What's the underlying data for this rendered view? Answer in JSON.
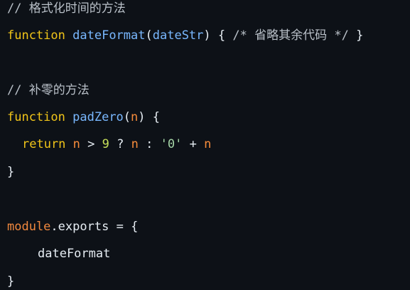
{
  "code": {
    "line1": {
      "comment": "// 格式化时间的方法"
    },
    "line2": {
      "keyword": "function",
      "fn_name": "dateFormat",
      "open_paren": "(",
      "param": "dateStr",
      "close_paren": ")",
      "brace_open": "{",
      "comment": "/* 省略其余代码 */",
      "brace_close": "}"
    },
    "line3": {
      "comment": "// 补零的方法"
    },
    "line4": {
      "keyword": "function",
      "fn_name": "padZero",
      "open_paren": "(",
      "param": "n",
      "close_paren": ")",
      "brace_open": "{"
    },
    "line5": {
      "keyword": "return",
      "ident1": "n",
      "op1": ">",
      "number": "9",
      "op2": "?",
      "ident2": "n",
      "op3": ":",
      "string": "'0'",
      "op4": "+",
      "ident3": "n"
    },
    "line6": {
      "brace_close": "}"
    },
    "line7": {
      "object": "module",
      "dot": ".",
      "property": "exports",
      "op": "=",
      "brace_open": "{"
    },
    "line8": {
      "property": "dateFormat"
    },
    "line9": {
      "brace_close": "}"
    }
  },
  "colors": {
    "background": "#0d1117",
    "keyword": "#f0c419",
    "function_name": "#79b8ff",
    "comment": "#b9c0c8",
    "number": "#c7e05a",
    "identifier": "#f78c3b",
    "string": "#a5d6a7"
  }
}
